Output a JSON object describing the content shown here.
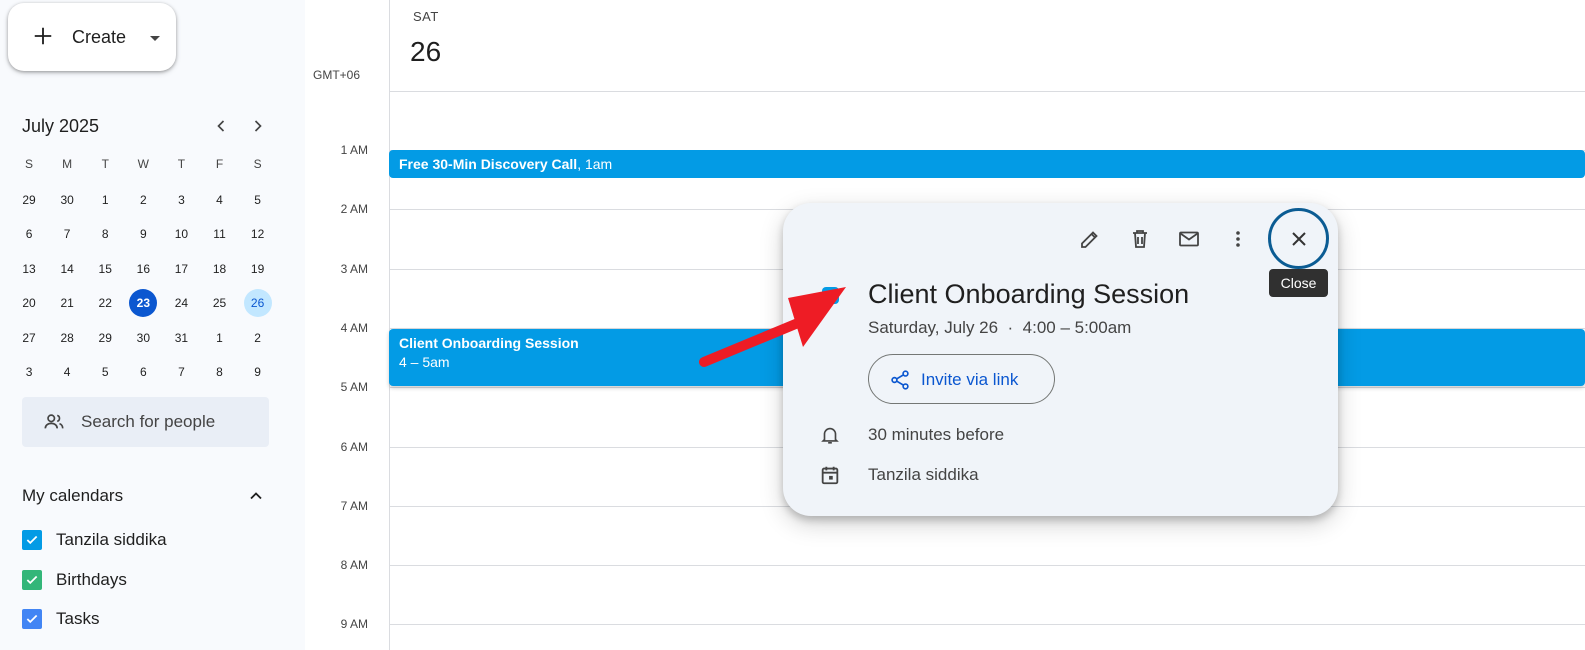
{
  "sidebar": {
    "create_label": "Create",
    "mini_calendar": {
      "month_title": "July 2025",
      "weekdays": [
        "S",
        "M",
        "T",
        "W",
        "T",
        "F",
        "S"
      ],
      "weeks": [
        [
          "29",
          "30",
          "1",
          "2",
          "3",
          "4",
          "5"
        ],
        [
          "6",
          "7",
          "8",
          "9",
          "10",
          "11",
          "12"
        ],
        [
          "13",
          "14",
          "15",
          "16",
          "17",
          "18",
          "19"
        ],
        [
          "20",
          "21",
          "22",
          "23",
          "24",
          "25",
          "26"
        ],
        [
          "27",
          "28",
          "29",
          "30",
          "31",
          "1",
          "2"
        ],
        [
          "3",
          "4",
          "5",
          "6",
          "7",
          "8",
          "9"
        ]
      ],
      "today": "23",
      "selected": "26"
    },
    "search_people_label": "Search for people",
    "my_calendars_title": "My calendars",
    "calendars": [
      {
        "label": "Tanzila siddika",
        "color": "#039be5"
      },
      {
        "label": "Birthdays",
        "color": "#33b679"
      },
      {
        "label": "Tasks",
        "color": "#4285f4"
      }
    ]
  },
  "day_view": {
    "day_name": "SAT",
    "day_number": "26",
    "timezone": "GMT+06",
    "hours": [
      "1 AM",
      "2 AM",
      "3 AM",
      "4 AM",
      "5 AM",
      "6 AM",
      "7 AM",
      "8 AM",
      "9 AM"
    ],
    "events": [
      {
        "title": "Free 30-Min Discovery Call",
        "time": ", 1am"
      },
      {
        "title": "Client Onboarding Session",
        "time": "4 – 5am"
      }
    ]
  },
  "popup": {
    "title": "Client Onboarding Session",
    "subtitle": "Saturday, July 26  ·  4:00 – 5:00am",
    "invite_label": "Invite via link",
    "reminder": "30 minutes before",
    "calendar": "Tanzila siddika",
    "close_tooltip": "Close",
    "event_color": "#039be5"
  },
  "icons": {
    "edit": "pencil-icon",
    "delete": "trash-icon",
    "email": "mail-icon",
    "more": "more-vert-icon",
    "close": "close-icon"
  },
  "colors": {
    "accent": "#0b57d0",
    "event": "#039be5",
    "annotation_arrow": "#ee1c25"
  }
}
